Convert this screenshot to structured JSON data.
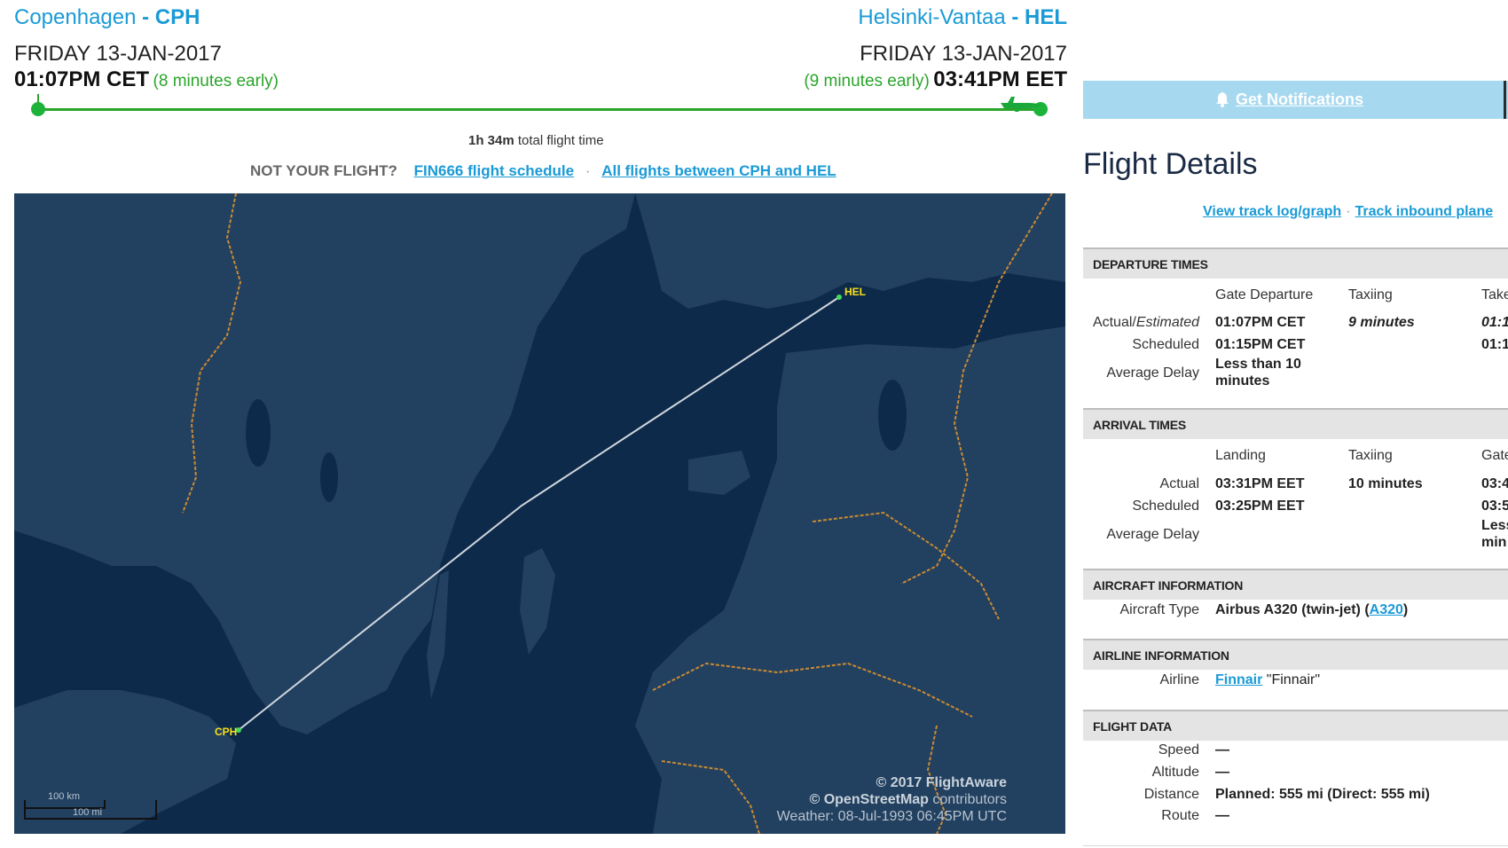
{
  "origin": {
    "city": "Copenhagen",
    "separator": " - ",
    "code": "CPH",
    "date": "FRIDAY 13-JAN-2017",
    "time": "01:07PM CET",
    "early": "(8 minutes early)"
  },
  "destination": {
    "city": "Helsinki-Vantaa",
    "separator": " - ",
    "code": "HEL",
    "date": "FRIDAY 13-JAN-2017",
    "time": "03:41PM EET",
    "early": "(9 minutes early)"
  },
  "progress": 1.0,
  "total_time": {
    "duration": "1h 34m",
    "suffix": "total flight time"
  },
  "not_your_flight": {
    "label": "NOT YOUR FLIGHT?",
    "schedule_link": "FIN666 flight schedule",
    "separator": "·",
    "all_flights_link": "All flights between CPH and HEL"
  },
  "map": {
    "origin_label": "CPH",
    "destination_label": "HEL",
    "scale_km": "100 km",
    "scale_mi": "100 mi",
    "copyright": "© 2017 FlightAware",
    "osm_bold": "© OpenStreetMap",
    "osm_rest": " contributors",
    "weather": "Weather: 08-Jul-1993 06:45PM UTC",
    "colors": {
      "sea": "#0e2a4a",
      "land": "#22405f",
      "border": "#c98a34",
      "route": "#cfd6dd",
      "airport": "#f6e11a"
    }
  },
  "notifications": {
    "label": "Get Notifications",
    "icon": "bell-icon"
  },
  "flight_details": {
    "title": "Flight Details",
    "track_log_link": "View track log/graph",
    "separator": "·",
    "inbound_link": "Track inbound plane"
  },
  "departure": {
    "title": "DEPARTURE TIMES",
    "columns": [
      "Gate Departure",
      "Taxiing",
      "Take"
    ],
    "actual_label_a": "Actual/",
    "actual_label_b": "Estimated",
    "actual": [
      "01:07PM CET",
      "9 minutes",
      "01:1"
    ],
    "scheduled_label": "Scheduled",
    "scheduled": [
      "01:15PM CET",
      "01:1"
    ],
    "avg_delay_label": "Average Delay",
    "avg_delay_l1": "Less than 10",
    "avg_delay_l2": "minutes"
  },
  "arrival": {
    "title": "ARRIVAL TIMES",
    "columns": [
      "Landing",
      "Taxiing",
      "Gate"
    ],
    "actual_label": "Actual",
    "actual": [
      "03:31PM EET",
      "10 minutes",
      "03:4"
    ],
    "scheduled_label": "Scheduled",
    "scheduled": [
      "03:25PM EET",
      "03:5"
    ],
    "avg_delay_label": "Average Delay",
    "avg_delay_l1": "Less",
    "avg_delay_l2": "min"
  },
  "aircraft": {
    "title": "AIRCRAFT INFORMATION",
    "type_label": "Aircraft Type",
    "type_value": "Airbus A320 (twin-jet) (",
    "type_link": "A320",
    "type_close": ")"
  },
  "airline": {
    "title": "AIRLINE INFORMATION",
    "label": "Airline",
    "link": "Finnair",
    "callsign": " \"Finnair\""
  },
  "flight_data": {
    "title": "FLIGHT DATA",
    "speed_label": "Speed",
    "speed": "—",
    "altitude_label": "Altitude",
    "altitude": "—",
    "distance_label": "Distance",
    "distance": "Planned: 555 mi (Direct: 555 mi)",
    "route_label": "Route",
    "route": "—"
  }
}
